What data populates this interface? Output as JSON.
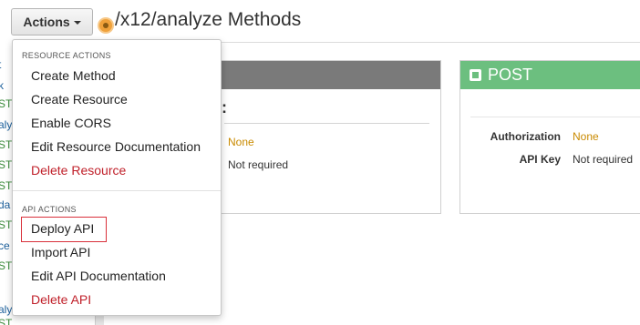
{
  "header": {
    "actions_label": "Actions",
    "page_title": "/x12/analyze Methods"
  },
  "left_tree": {
    "fragments": [
      {
        "text": "t",
        "color": "blue"
      },
      {
        "text": "k",
        "color": "blue"
      },
      {
        "text": "ST",
        "color": "green"
      },
      {
        "text": "aly",
        "color": "blue"
      },
      {
        "text": "ST",
        "color": "green"
      },
      {
        "text": "ST",
        "color": "green"
      },
      {
        "text": "d",
        "color": "blue"
      },
      {
        "text": "ST",
        "color": "green"
      },
      {
        "text": "da",
        "color": "blue"
      },
      {
        "text": "ST",
        "color": "green"
      },
      {
        "text": "ce",
        "color": "blue"
      },
      {
        "text": "ST",
        "color": "green"
      },
      {
        "text": "aly",
        "color": "blue"
      },
      {
        "text": "ST",
        "color": "green"
      }
    ]
  },
  "menu": {
    "resource_header": "RESOURCE ACTIONS",
    "resource_items": [
      {
        "label": "Create Method",
        "danger": false
      },
      {
        "label": "Create Resource",
        "danger": false
      },
      {
        "label": "Enable CORS",
        "danger": false
      },
      {
        "label": "Edit Resource Documentation",
        "danger": false
      },
      {
        "label": "Delete Resource",
        "danger": true
      }
    ],
    "api_header": "API ACTIONS",
    "api_items": [
      {
        "label": "Deploy API",
        "danger": false
      },
      {
        "label": "Import API",
        "danger": false
      },
      {
        "label": "Edit API Documentation",
        "danger": false
      },
      {
        "label": "Delete API",
        "danger": true
      }
    ]
  },
  "card_left": {
    "header_fragment": ":",
    "authorization_value": "None",
    "api_key_value": "Not required"
  },
  "card_post": {
    "method": "POST",
    "icon": "cube-icon",
    "authorization_label": "Authorization",
    "authorization_value": "None",
    "api_key_label": "API Key",
    "api_key_value": "Not required"
  },
  "colors": {
    "post_header": "#6cbf7f",
    "left_card_header": "#7a7a7a",
    "danger_text": "#c0202a",
    "highlight_border": "#d9303a",
    "authorization_value": "#c98a00"
  }
}
